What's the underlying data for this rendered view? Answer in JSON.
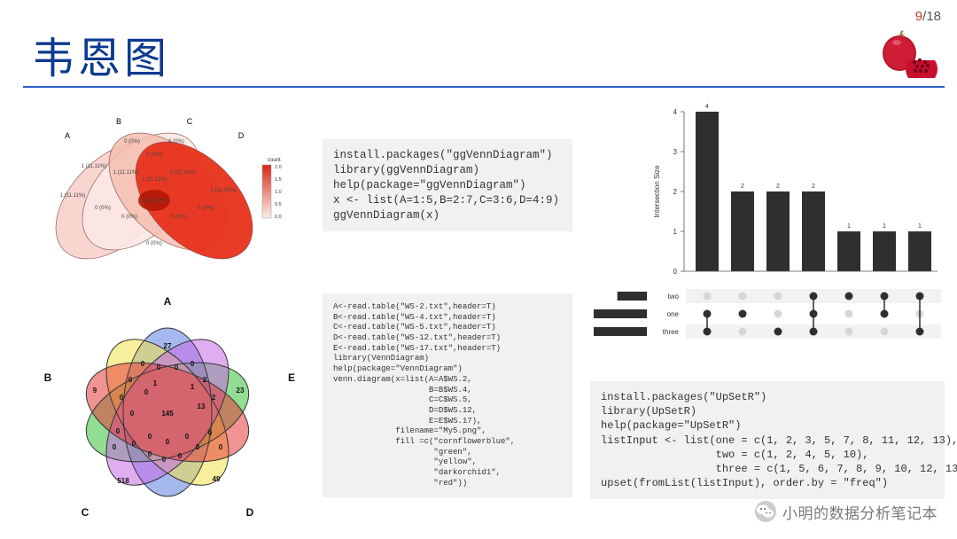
{
  "slide": {
    "title": "韦恩图",
    "page_current": "9",
    "page_total": "18",
    "watermark": "小明的数据分析笔记本"
  },
  "code": {
    "ggvenn": "install.packages(\"ggVennDiagram\")\nlibrary(ggVennDiagram)\nhelp(package=\"ggVennDiagram\")\nx <- list(A=1:5,B=2:7,C=3:6,D=4:9)\nggVennDiagram(x)",
    "venndiagram": "A<-read.table(\"WS-2.txt\",header=T)\nB<-read.table(\"WS-4.txt\",header=T)\nC<-read.table(\"WS-5.txt\",header=T)\nD<-read.table(\"WS-12.txt\",header=T)\nE<-read.table(\"WS-17.txt\",header=T)\nlibrary(VennDiagram)\nhelp(package=\"VennDiagram\")\nvenn.diagram(x=list(A=A$WS.2,\n                    B=B$WS.4,\n                    C=C$WS.5,\n                    D=D$WS.12,\n                    E=E$WS.17),\n             filename=\"My5.png\",\n             fill =c(\"cornflowerblue\",\n                     \"green\",\n                     \"yellow\",\n                     \"darkorchid1\",\n                     \"red\"))",
    "upsetr": "install.packages(\"UpSetR\")\nlibrary(UpSetR)\nhelp(package=\"UpSetR\")\nlistInput <- list(one = c(1, 2, 3, 5, 7, 8, 11, 12, 13),\n                  two = c(1, 2, 4, 5, 10),\n                  three = c(1, 5, 6, 7, 8, 9, 10, 12, 13))\nupset(fromList(listInput), order.by = \"freq\")"
  },
  "venn4": {
    "sets": [
      "A",
      "B",
      "C",
      "D"
    ],
    "region_labels": [
      "0\n(0%)",
      "0\n(0%)",
      "0\n(0%)",
      "1\n(11.11%)",
      "1\n(11.11%)",
      "1\n(11.11%)",
      "1\n(11.11%)",
      "1\n(11.11%)",
      "0\n(0%)",
      "0\n(0%)",
      "2\n(22.22%)",
      "2\n(22.22%)",
      "0\n(0%)",
      "0\n(0%)",
      "0\n(0%)"
    ],
    "legend": {
      "title": "count",
      "ticks": [
        "2.0",
        "1.5",
        "1.0",
        "0.5",
        "0.0"
      ]
    }
  },
  "venn5": {
    "set_labels": [
      "A",
      "B",
      "C",
      "D",
      "E"
    ],
    "center": "145",
    "outer_numbers": [
      "27",
      "9",
      "518",
      "49",
      "23"
    ],
    "ring_numbers": [
      "0",
      "0",
      "0",
      "0",
      "2",
      "2",
      "1",
      "13",
      "0",
      "0",
      "0",
      "0",
      "0",
      "0",
      "0",
      "0",
      "0",
      "0",
      "0",
      "0",
      "0",
      "0",
      "0",
      "0",
      "1"
    ]
  },
  "chart_data": {
    "type": "bar",
    "title": "",
    "ylabel": "Intersection Size",
    "ylim": [
      0,
      4
    ],
    "yticks": [
      0,
      1,
      2,
      3,
      4
    ],
    "sets": [
      "two",
      "one",
      "three"
    ],
    "set_sizes": {
      "two": 5,
      "one": 9,
      "three": 9
    },
    "intersections": [
      {
        "sets": [
          "one",
          "three"
        ],
        "size": 4
      },
      {
        "sets": [
          "one"
        ],
        "size": 2
      },
      {
        "sets": [
          "three"
        ],
        "size": 2
      },
      {
        "sets": [
          "two",
          "one",
          "three"
        ],
        "size": 2
      },
      {
        "sets": [
          "two"
        ],
        "size": 1
      },
      {
        "sets": [
          "two",
          "one"
        ],
        "size": 1
      },
      {
        "sets": [
          "two",
          "three"
        ],
        "size": 1
      }
    ]
  }
}
